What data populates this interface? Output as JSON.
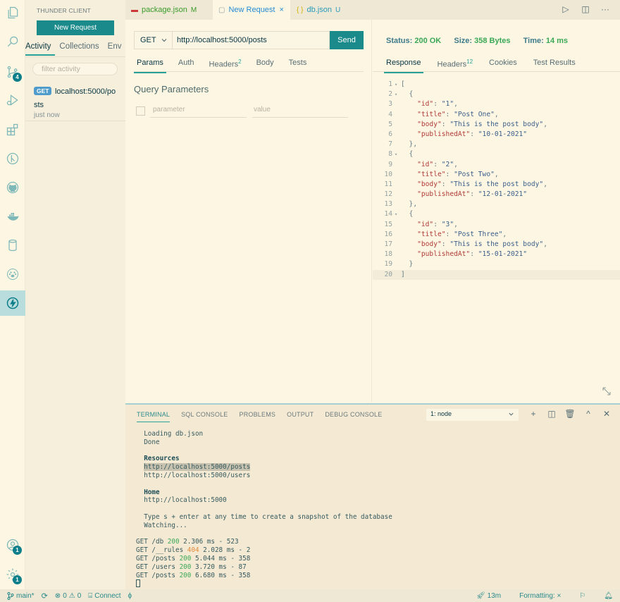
{
  "activity_bar": {
    "icons": [
      {
        "name": "explorer-icon"
      },
      {
        "name": "search-icon"
      },
      {
        "name": "source-control-icon",
        "badge": "4"
      },
      {
        "name": "run-debug-icon"
      },
      {
        "name": "extensions-icon"
      },
      {
        "name": "git-graph-icon"
      },
      {
        "name": "github-icon"
      },
      {
        "name": "docker-icon"
      },
      {
        "name": "database-icon"
      },
      {
        "name": "paw-icon"
      },
      {
        "name": "thunder-client-icon",
        "active": true
      }
    ],
    "bottom": [
      {
        "name": "accounts-icon",
        "badge": "1"
      },
      {
        "name": "settings-gear-icon",
        "badge": "1"
      }
    ]
  },
  "sidebar": {
    "title": "THUNDER CLIENT",
    "new_request_label": "New Request",
    "tabs": [
      "Activity",
      "Collections",
      "Env"
    ],
    "active_tab": "Activity",
    "filter_placeholder": "filter activity",
    "activity_items": [
      {
        "method": "GET",
        "url_line1": "localhost:5000/po",
        "url_line2": "sts",
        "time": "just now"
      }
    ]
  },
  "editor_tabs": [
    {
      "label": "package.json",
      "status": "M",
      "icon": "npm-icon",
      "active": false
    },
    {
      "label": "New Request",
      "status": "×",
      "icon": "file-icon",
      "active": true
    },
    {
      "label": "db.json",
      "status": "U",
      "icon": "{ }",
      "active": false
    }
  ],
  "tab_actions": [
    "run-icon",
    "split-editor-icon",
    "more-icon"
  ],
  "request": {
    "method": "GET",
    "url": "http://localhost:5000/posts",
    "send_label": "Send",
    "tabs": [
      {
        "label": "Params",
        "active": true
      },
      {
        "label": "Auth"
      },
      {
        "label": "Headers",
        "count": "2"
      },
      {
        "label": "Body"
      },
      {
        "label": "Tests"
      }
    ],
    "query_title": "Query Parameters",
    "param_placeholder": "parameter",
    "value_placeholder": "value"
  },
  "response": {
    "status_label": "Status:",
    "status_value": "200 OK",
    "size_label": "Size:",
    "size_value": "358 Bytes",
    "time_label": "Time:",
    "time_value": "14 ms",
    "tabs": [
      {
        "label": "Response",
        "active": true
      },
      {
        "label": "Headers",
        "count": "12"
      },
      {
        "label": "Cookies"
      },
      {
        "label": "Test Results"
      }
    ],
    "lines": [
      {
        "n": "1",
        "fold": true,
        "parts": [
          [
            "t",
            "["
          ]
        ]
      },
      {
        "n": "2",
        "fold": true,
        "parts": [
          [
            "t",
            "  {"
          ]
        ]
      },
      {
        "n": "3",
        "parts": [
          [
            "t",
            "    "
          ],
          [
            "k",
            "\"id\""
          ],
          [
            "t",
            ": "
          ],
          [
            "s",
            "\"1\""
          ],
          [
            "t",
            ","
          ]
        ]
      },
      {
        "n": "4",
        "parts": [
          [
            "t",
            "    "
          ],
          [
            "k",
            "\"title\""
          ],
          [
            "t",
            ": "
          ],
          [
            "s",
            "\"Post One\""
          ],
          [
            "t",
            ","
          ]
        ]
      },
      {
        "n": "5",
        "parts": [
          [
            "t",
            "    "
          ],
          [
            "k",
            "\"body\""
          ],
          [
            "t",
            ": "
          ],
          [
            "s",
            "\"This is the post body\""
          ],
          [
            "t",
            ","
          ]
        ]
      },
      {
        "n": "6",
        "parts": [
          [
            "t",
            "    "
          ],
          [
            "k",
            "\"publishedAt\""
          ],
          [
            "t",
            ": "
          ],
          [
            "s",
            "\"10-01-2021\""
          ]
        ]
      },
      {
        "n": "7",
        "parts": [
          [
            "t",
            "  },"
          ]
        ]
      },
      {
        "n": "8",
        "fold": true,
        "parts": [
          [
            "t",
            "  {"
          ]
        ]
      },
      {
        "n": "9",
        "parts": [
          [
            "t",
            "    "
          ],
          [
            "k",
            "\"id\""
          ],
          [
            "t",
            ": "
          ],
          [
            "s",
            "\"2\""
          ],
          [
            "t",
            ","
          ]
        ]
      },
      {
        "n": "10",
        "parts": [
          [
            "t",
            "    "
          ],
          [
            "k",
            "\"title\""
          ],
          [
            "t",
            ": "
          ],
          [
            "s",
            "\"Post Two\""
          ],
          [
            "t",
            ","
          ]
        ]
      },
      {
        "n": "11",
        "parts": [
          [
            "t",
            "    "
          ],
          [
            "k",
            "\"body\""
          ],
          [
            "t",
            ": "
          ],
          [
            "s",
            "\"This is the post body\""
          ],
          [
            "t",
            ","
          ]
        ]
      },
      {
        "n": "12",
        "parts": [
          [
            "t",
            "    "
          ],
          [
            "k",
            "\"publishedAt\""
          ],
          [
            "t",
            ": "
          ],
          [
            "s",
            "\"12-01-2021\""
          ]
        ]
      },
      {
        "n": "13",
        "parts": [
          [
            "t",
            "  },"
          ]
        ]
      },
      {
        "n": "14",
        "fold": true,
        "parts": [
          [
            "t",
            "  {"
          ]
        ]
      },
      {
        "n": "15",
        "parts": [
          [
            "t",
            "    "
          ],
          [
            "k",
            "\"id\""
          ],
          [
            "t",
            ": "
          ],
          [
            "s",
            "\"3\""
          ],
          [
            "t",
            ","
          ]
        ]
      },
      {
        "n": "16",
        "parts": [
          [
            "t",
            "    "
          ],
          [
            "k",
            "\"title\""
          ],
          [
            "t",
            ": "
          ],
          [
            "s",
            "\"Post Three\""
          ],
          [
            "t",
            ","
          ]
        ]
      },
      {
        "n": "17",
        "parts": [
          [
            "t",
            "    "
          ],
          [
            "k",
            "\"body\""
          ],
          [
            "t",
            ": "
          ],
          [
            "s",
            "\"This is the post body\""
          ],
          [
            "t",
            ","
          ]
        ]
      },
      {
        "n": "18",
        "parts": [
          [
            "t",
            "    "
          ],
          [
            "k",
            "\"publishedAt\""
          ],
          [
            "t",
            ": "
          ],
          [
            "s",
            "\"15-01-2021\""
          ]
        ]
      },
      {
        "n": "19",
        "parts": [
          [
            "t",
            "  }"
          ]
        ]
      },
      {
        "n": "20",
        "current": true,
        "parts": [
          [
            "t",
            "]"
          ]
        ]
      }
    ]
  },
  "panel": {
    "tabs": [
      {
        "label": "TERMINAL",
        "active": true
      },
      {
        "label": "SQL CONSOLE"
      },
      {
        "label": "PROBLEMS"
      },
      {
        "label": "OUTPUT"
      },
      {
        "label": "DEBUG CONSOLE"
      }
    ],
    "terminal_select": "1: node",
    "actions": [
      "new-terminal-icon",
      "split-terminal-icon",
      "trash-icon",
      "maximize-panel-icon",
      "close-panel-icon"
    ],
    "terminal_lines": [
      [
        [
          "n",
          "  Loading db.json"
        ]
      ],
      [
        [
          "n",
          "  Done"
        ]
      ],
      [
        [
          "n",
          ""
        ]
      ],
      [
        [
          "b",
          "  Resources"
        ]
      ],
      [
        [
          "n",
          "  "
        ],
        [
          "h",
          "http://localhost:5000/posts"
        ]
      ],
      [
        [
          "n",
          "  http://localhost:5000/users"
        ]
      ],
      [
        [
          "n",
          ""
        ]
      ],
      [
        [
          "b",
          "  Home"
        ]
      ],
      [
        [
          "n",
          "  http://localhost:5000"
        ]
      ],
      [
        [
          "n",
          ""
        ]
      ],
      [
        [
          "n",
          "  Type s + enter at any time to create a snapshot of the database"
        ]
      ],
      [
        [
          "n",
          "  Watching..."
        ]
      ],
      [
        [
          "n",
          ""
        ]
      ],
      [
        [
          "n",
          "GET /db "
        ],
        [
          "ok",
          "200"
        ],
        [
          "n",
          " 2.306 ms - 523"
        ]
      ],
      [
        [
          "n",
          "GET /__rules "
        ],
        [
          "w",
          "404"
        ],
        [
          "n",
          " 2.028 ms - 2"
        ]
      ],
      [
        [
          "n",
          "GET /posts "
        ],
        [
          "ok",
          "200"
        ],
        [
          "n",
          " 5.044 ms - 358"
        ]
      ],
      [
        [
          "n",
          "GET /users "
        ],
        [
          "ok",
          "200"
        ],
        [
          "n",
          " 3.720 ms - 87"
        ]
      ],
      [
        [
          "n",
          "GET /posts "
        ],
        [
          "ok",
          "200"
        ],
        [
          "n",
          " 6.680 ms - 358"
        ]
      ]
    ]
  },
  "statusbar": {
    "branch": "main*",
    "errors": "0",
    "warnings": "0",
    "connect": "Connect",
    "time_elapsed": "13m",
    "formatting": "Formatting: ×"
  }
}
